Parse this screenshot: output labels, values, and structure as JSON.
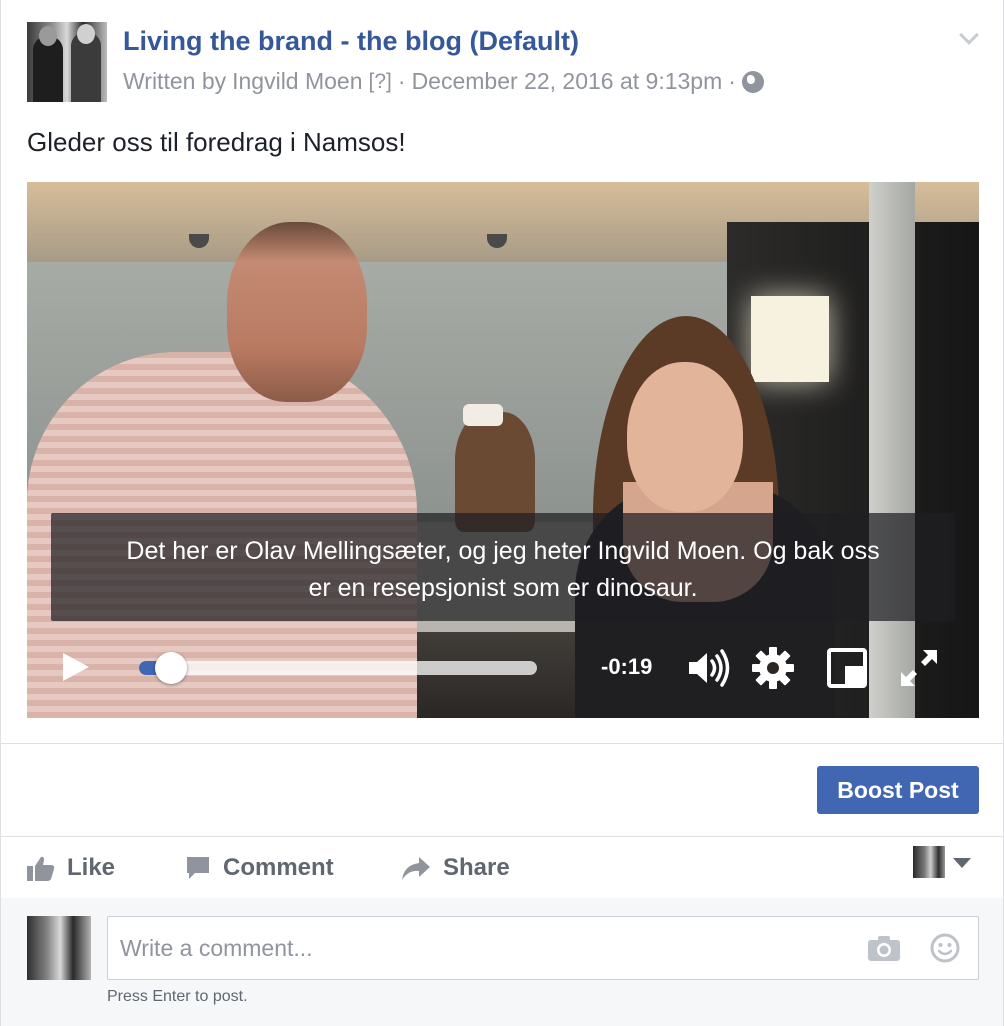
{
  "post": {
    "page_name": "Living the brand - the blog (Default)",
    "byline_prefix": "Written by",
    "author": "Ingvild Moen",
    "help_marker": "[?]",
    "separator": "·",
    "timestamp": "December 22, 2016 at 9:13pm",
    "audience_icon": "globe-icon",
    "text": "Gleder oss til foredrag i Namsos!"
  },
  "video": {
    "caption_line1": "Det her er Olav Mellingsæter, og jeg heter Ingvild Moen. Og bak oss",
    "caption_line2": "er en resepsjonist som er dinosaur.",
    "time_remaining": "-0:19",
    "progress_fraction": 0.08,
    "controls": [
      "play-icon",
      "volume-icon",
      "settings-icon",
      "pip-icon",
      "fullscreen-icon"
    ]
  },
  "boost": {
    "label": "Boost Post",
    "color": "#4267b2"
  },
  "actions": {
    "like": "Like",
    "comment": "Comment",
    "share": "Share"
  },
  "comment_box": {
    "placeholder": "Write a comment...",
    "hint": "Press Enter to post."
  },
  "colors": {
    "link": "#365899",
    "secondary_text": "#90949c",
    "action_text": "#606770"
  }
}
